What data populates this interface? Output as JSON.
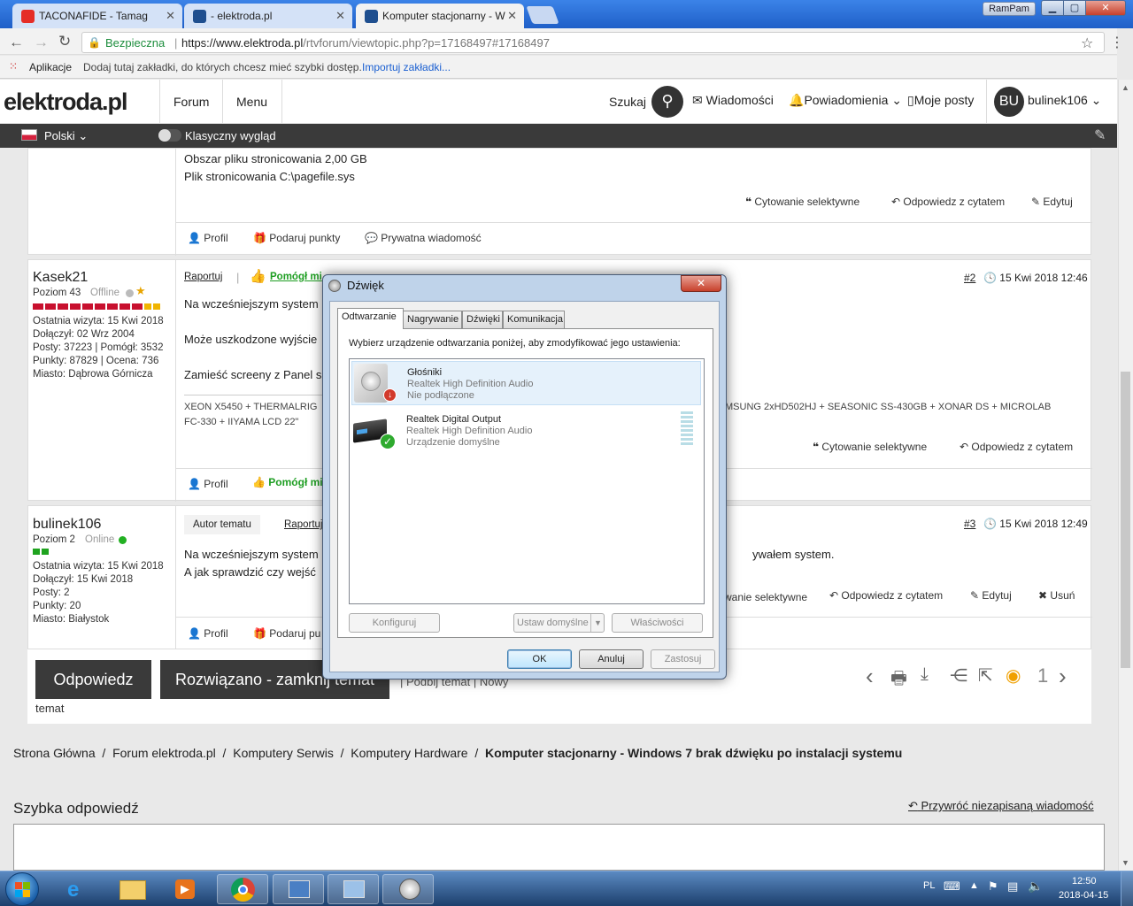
{
  "browser": {
    "tabs": [
      {
        "title": "TACONAFIDE - Tamag",
        "color": "#e52d27"
      },
      {
        "title": "- elektroda.pl",
        "color": "#1f4f8f"
      },
      {
        "title": "Komputer stacjonarny - W",
        "color": "#1f4f8f"
      }
    ],
    "ram_label": "RamPam",
    "secure_label": "Bezpieczna",
    "url_base": "https://www.elektroda.pl",
    "url_path": "/rtvforum/viewtopic.php?p=17168497#17168497",
    "bookmarks": {
      "apps": "Aplikacje",
      "hint": "Dodaj tutaj zakładki, do których chcesz mieć szybki dostęp.",
      "import": "Importuj zakładki..."
    }
  },
  "site": {
    "logo": "elektroda.pl",
    "nav": [
      "Forum",
      "Menu"
    ],
    "search_label": "Szukaj",
    "messages": "Wiadomości",
    "notifications": "Powiadomienia",
    "my_posts": "Moje posty",
    "user_initials": "BU",
    "username": "bulinek106",
    "language": "Polski",
    "classic_view": "Klasyczny wygląd"
  },
  "post0": {
    "lines": [
      "Obszar pliku stronicowania 2,00 GB",
      "Plik stronicowania C:\\pagefile.sys"
    ],
    "actions": [
      "Cytowanie selektywne",
      "Odpowiedz z cytatem",
      "Edytuj"
    ],
    "footer": [
      "Profil",
      "Podaruj punkty",
      "Prywatna wiadomość"
    ]
  },
  "post2": {
    "author": "Kasek21",
    "level": "Poziom 43",
    "status": "Offline",
    "last_visit": "Ostatnia wizyta: 15 Kwi 2018",
    "joined": "Dołączył: 02 Wrz 2004",
    "posts": "Posty: 37223 | Pomógł: 3532",
    "points": "Punkty: 87829 | Ocena: 736",
    "city": "Miasto: Dąbrowa Górnicza",
    "report": "Raportuj",
    "helped": "Pomógł mi",
    "num": "#2",
    "date": "15 Kwi 2018 12:46",
    "text1": "Na wcześniejszym system",
    "text2": "Może uszkodzone wyjście",
    "text3": "Zamieść screeny z Panel s",
    "sig1": "XEON X5450 + THERMALRIG",
    "sig1b": "MSUNG 2xHD502HJ + SEASONIC SS-430GB + XONAR DS + MICROLAB",
    "sig2": "FC-330 + IIYAMA LCD 22\"",
    "actions": [
      "Cytowanie selektywne",
      "Odpowiedz z cytatem"
    ],
    "footer": [
      "Profil",
      "Pomógł mi"
    ]
  },
  "post3": {
    "author": "bulinek106",
    "level": "Poziom 2",
    "status": "Online",
    "last_visit": "Ostatnia wizyta: 15 Kwi 2018",
    "joined": "Dołączył: 15 Kwi 2018",
    "posts": "Posty: 2",
    "points": "Punkty: 20",
    "city": "Miasto: Białystok",
    "badge": "Autor tematu",
    "report": "Raportuj",
    "num": "#3",
    "date": "15 Kwi 2018 12:49",
    "text1": "Na wcześniejszym system",
    "text1b": "ywałem system.",
    "text2": "A jak sprawdzić czy wejść",
    "actions": [
      "wanie selektywne",
      "Odpowiedz z cytatem",
      "Edytuj",
      "Usuń"
    ],
    "footer": [
      "Profil",
      "Podaruj pu"
    ]
  },
  "bottom": {
    "reply": "Odpowiedz",
    "solved": "Rozwiązano - zamknij temat",
    "topic": "temat",
    "bump": "Podbij temat",
    "new": "Nowy",
    "watchers": "1"
  },
  "breadcrumb": [
    "Strona Główna",
    "Forum elektroda.pl",
    "Komputery Serwis",
    "Komputery Hardware",
    "Komputer stacjonarny - Windows 7 brak dźwięku po instalacji systemu"
  ],
  "quick_reply": {
    "title": "Szybka odpowiedź",
    "restore": "Przywróć niezapisaną wiadomość"
  },
  "dialog": {
    "title": "Dźwięk",
    "tabs": [
      "Odtwarzanie",
      "Nagrywanie",
      "Dźwięki",
      "Komunikacja"
    ],
    "instruction": "Wybierz urządzenie odtwarzania poniżej, aby zmodyfikować jego ustawienia:",
    "devices": [
      {
        "name": "Głośniki",
        "driver": "Realtek High Definition Audio",
        "state": "Nie podłączone"
      },
      {
        "name": "Realtek Digital Output",
        "driver": "Realtek High Definition Audio",
        "state": "Urządzenie domyślne"
      }
    ],
    "configure": "Konfiguruj",
    "set_default": "Ustaw domyślne",
    "properties": "Właściwości",
    "ok": "OK",
    "cancel": "Anuluj",
    "apply": "Zastosuj"
  },
  "taskbar": {
    "lang": "PL",
    "time": "12:50",
    "date": "2018-04-15"
  }
}
